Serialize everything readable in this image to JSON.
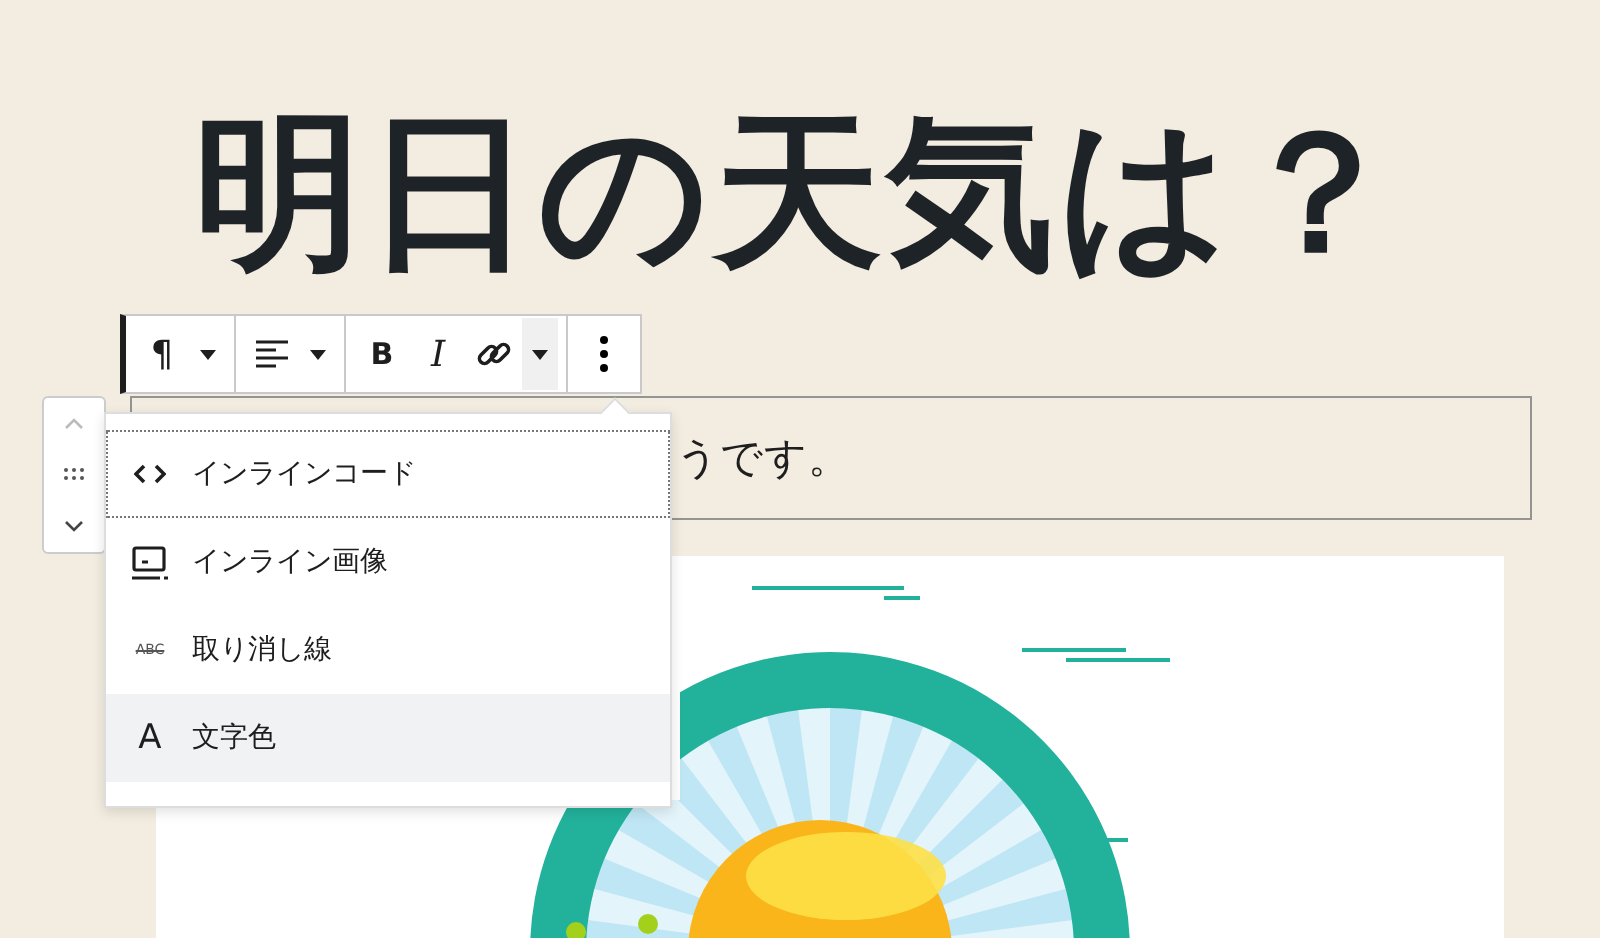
{
  "heading": "明日の天気は？",
  "toolbar": {
    "groups": [
      [
        {
          "kind": "glyph",
          "label": "¶"
        },
        {
          "kind": "caret"
        }
      ],
      [
        {
          "kind": "align"
        },
        {
          "kind": "caret"
        }
      ],
      [
        {
          "kind": "glyph",
          "label": "B"
        },
        {
          "kind": "italic",
          "label": "I"
        },
        {
          "kind": "link"
        },
        {
          "kind": "caret",
          "expanded": true
        }
      ],
      [
        {
          "kind": "more"
        }
      ]
    ]
  },
  "paragraph": {
    "text": "うです。"
  },
  "menu": {
    "items": [
      {
        "kind": "code",
        "label": "インラインコード",
        "focused": true,
        "selected": false
      },
      {
        "kind": "image",
        "label": "インライン画像",
        "focused": false,
        "selected": false
      },
      {
        "kind": "strikethrough",
        "icon_label": "ABC",
        "label": "取り消し線",
        "focused": false,
        "selected": false
      },
      {
        "kind": "color",
        "icon_label": "A",
        "label": "文字色",
        "focused": false,
        "selected": true
      }
    ]
  }
}
